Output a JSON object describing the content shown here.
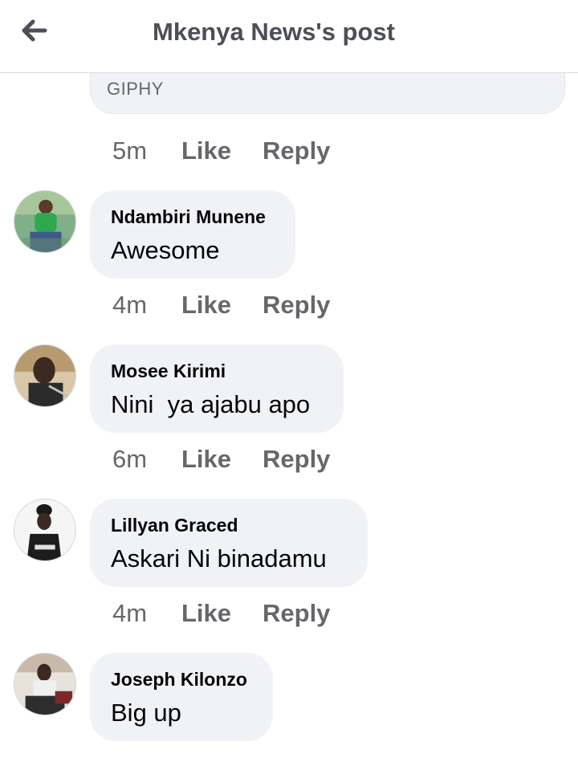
{
  "header": {
    "title": "Mkenya News's post"
  },
  "giphy": {
    "label": "GIPHY"
  },
  "first_actions": {
    "time": "5m",
    "like": "Like",
    "reply": "Reply"
  },
  "comments": [
    {
      "author": "Ndambiri Munene",
      "text": "Awesome",
      "time": "4m",
      "like": "Like",
      "reply": "Reply"
    },
    {
      "author": "Mosee Kirimi",
      "text": "Nini  ya ajabu apo",
      "time": "6m",
      "like": "Like",
      "reply": "Reply"
    },
    {
      "author": "Lillyan Graced",
      "text": "Askari Ni binadamu",
      "time": "4m",
      "like": "Like",
      "reply": "Reply"
    },
    {
      "author": "Joseph Kilonzo",
      "text": "Big up"
    }
  ],
  "colors": {
    "accent_text": "#65676b",
    "bubble_bg": "#f0f2f5",
    "header_title": "#4b4f56"
  },
  "icons": {
    "back": "arrow-left-icon"
  }
}
